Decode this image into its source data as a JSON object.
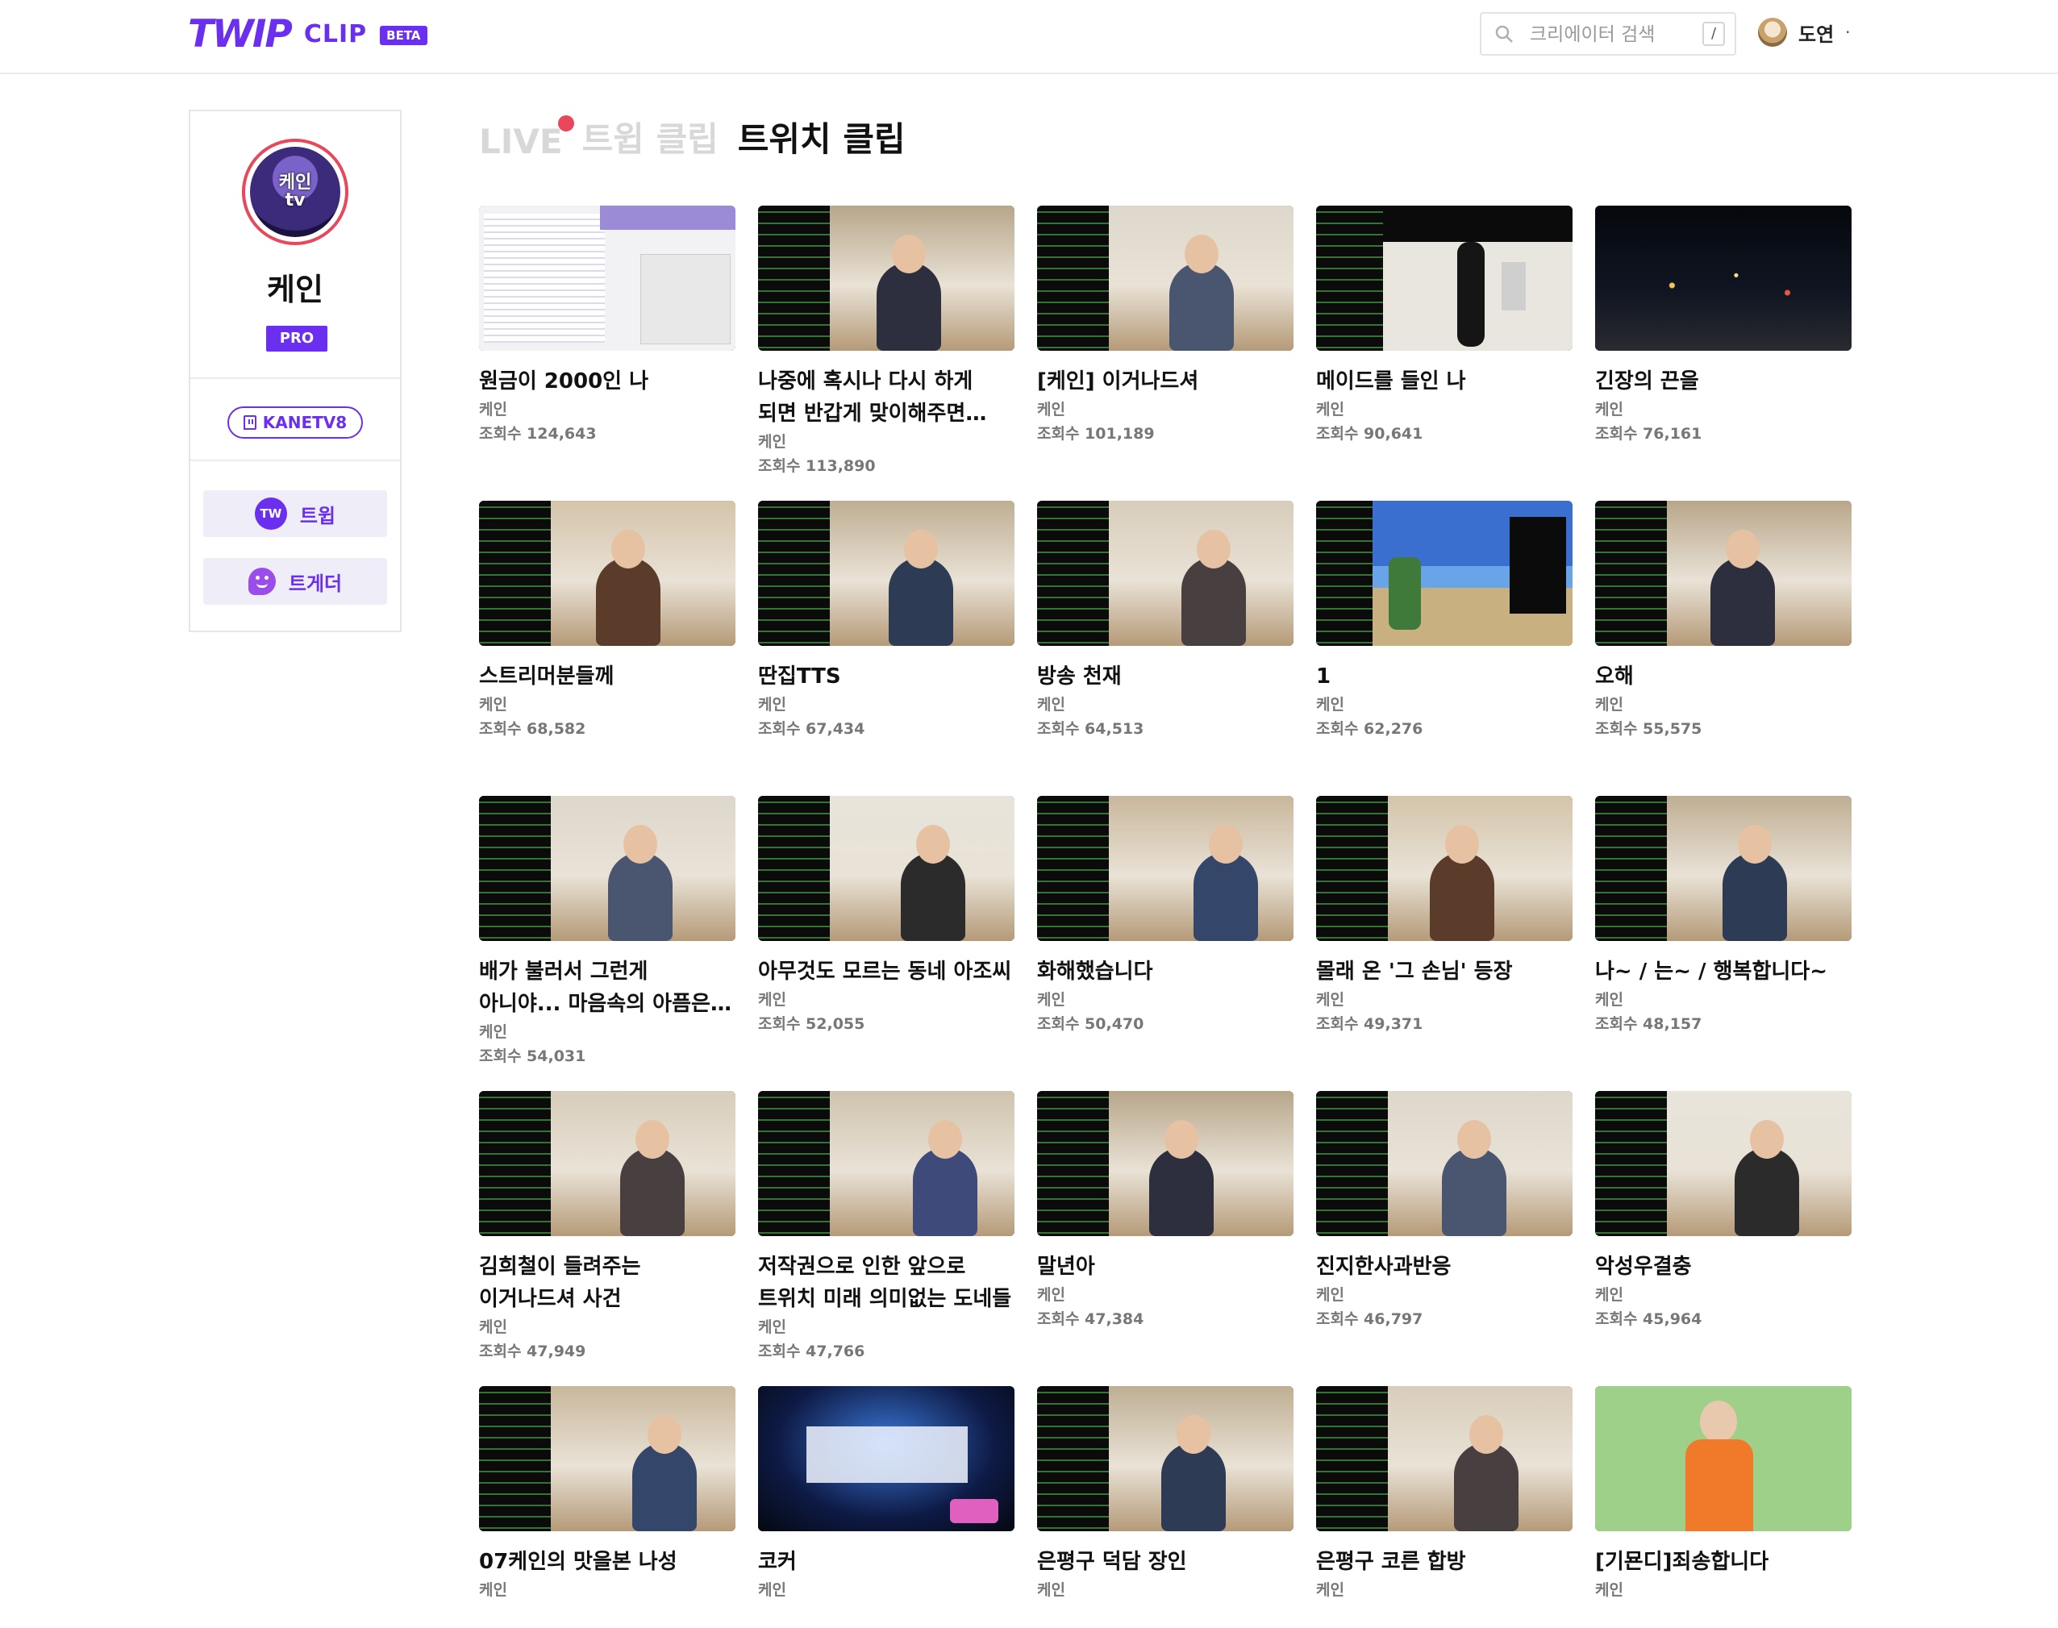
{
  "header": {
    "logo_main": "TWIP",
    "logo_sub": "CLIP",
    "logo_badge": "BETA",
    "search_placeholder": "크리에이터 검색",
    "search_shortcut": "/",
    "user_name": "도연",
    "user_caret": "·"
  },
  "sidebar": {
    "avatar_text": [
      "케인",
      "tv"
    ],
    "name": "케인",
    "badge": "PRO",
    "twitch_id": "KANETV8",
    "buttons": [
      {
        "icon_text": "TW",
        "label": "트윕"
      },
      {
        "icon_text": "",
        "label": "트게더"
      }
    ]
  },
  "tabs": [
    "LIVE",
    "트윕 클립",
    "트위치 클립"
  ],
  "active_tab": "트위치 클립",
  "view_prefix": "조회수",
  "clips": [
    {
      "title": "원금이 2000인 나",
      "channel": "케인",
      "views": "조회수 124,643",
      "thumb": "screen"
    },
    {
      "title": "나중에 혹시나 다시 하게 되면 반갑게 맞이해주면 되겠지....",
      "channel": "케인",
      "views": "조회수 113,890",
      "thumb": "room"
    },
    {
      "title": "[케인] 이거나드셔",
      "channel": "케인",
      "views": "조회수 101,189",
      "thumb": "office"
    },
    {
      "title": "메이드를 들인 나",
      "channel": "케인",
      "views": "조회수 90,641",
      "thumb": "maid"
    },
    {
      "title": "긴장의 끈을",
      "channel": "케인",
      "views": "조회수 76,161",
      "thumb": "night"
    },
    {
      "title": "스트리머분들께",
      "channel": "케인",
      "views": "조회수 68,582",
      "thumb": "room"
    },
    {
      "title": "딴집TTS",
      "channel": "케인",
      "views": "조회수 67,434",
      "thumb": "room"
    },
    {
      "title": "방송 천재",
      "channel": "케인",
      "views": "조회수 64,513",
      "thumb": "room"
    },
    {
      "title": "1",
      "channel": "케인",
      "views": "조회수 62,276",
      "thumb": "game"
    },
    {
      "title": "오해",
      "channel": "케인",
      "views": "조회수 55,575",
      "thumb": "room"
    },
    {
      "title": "배가 불러서 그런게 아니야... 마음속의 아픔은 참 당해보...",
      "channel": "케인",
      "views": "조회수 54,031",
      "thumb": "room"
    },
    {
      "title": "아무것도 모르는 동네 아조씨",
      "channel": "케인",
      "views": "조회수 52,055",
      "thumb": "room"
    },
    {
      "title": "화해했습니다",
      "channel": "케인",
      "views": "조회수 50,470",
      "thumb": "room"
    },
    {
      "title": "몰래 온 '그 손님' 등장",
      "channel": "케인",
      "views": "조회수 49,371",
      "thumb": "room"
    },
    {
      "title": "나~ / 는~ / 행복합니다~",
      "channel": "케인",
      "views": "조회수 48,157",
      "thumb": "room"
    },
    {
      "title": "김희철이 들려주는 이거나드셔 사건",
      "channel": "케인",
      "views": "조회수 47,949",
      "thumb": "room"
    },
    {
      "title": "저작권으로 인한 앞으로 트위치 미래 의미없는 도네들",
      "channel": "케인",
      "views": "조회수 47,766",
      "thumb": "room"
    },
    {
      "title": "말년아",
      "channel": "케인",
      "views": "조회수 47,384",
      "thumb": "room"
    },
    {
      "title": "진지한사과반응",
      "channel": "케인",
      "views": "조회수 46,797",
      "thumb": "room"
    },
    {
      "title": "악성우결충",
      "channel": "케인",
      "views": "조회수 45,964",
      "thumb": "room"
    },
    {
      "title": "07케인의 맛을본 나성",
      "channel": "케인",
      "views": "",
      "thumb": "room"
    },
    {
      "title": "코커",
      "channel": "케인",
      "views": "",
      "thumb": "stage"
    },
    {
      "title": "은평구 덕담 장인",
      "channel": "케인",
      "views": "",
      "thumb": "room"
    },
    {
      "title": "은평구 코른 합방",
      "channel": "케인",
      "views": "",
      "thumb": "room"
    },
    {
      "title": "[기묜디]죄송합니다",
      "channel": "케인",
      "views": "",
      "thumb": "green"
    }
  ],
  "colors": {
    "accent": "#6b2ff0",
    "live": "#e8475c"
  }
}
